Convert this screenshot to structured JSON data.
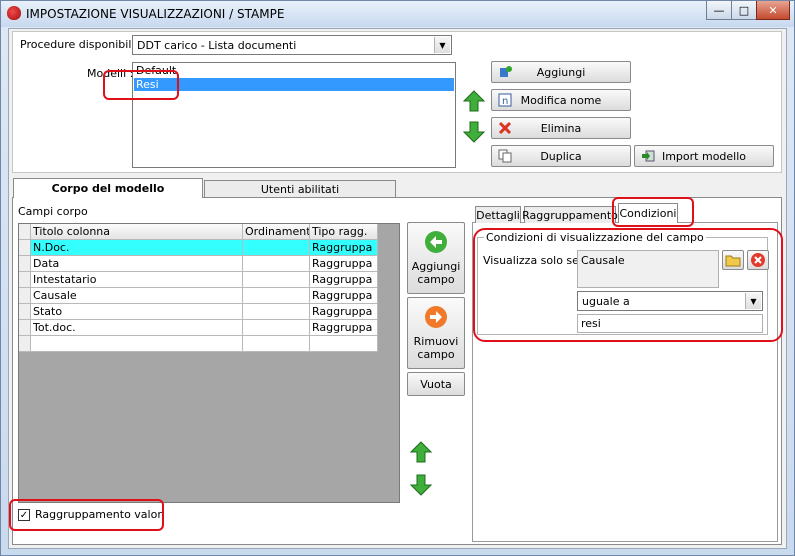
{
  "window": {
    "title": "IMPOSTAZIONE VISUALIZZAZIONI / STAMPE"
  },
  "procedure": {
    "label": "Procedure disponibili :",
    "value": "DDT carico - Lista documenti"
  },
  "modelli": {
    "label": "Modelli :",
    "items": [
      "Default",
      "Resi"
    ],
    "selected_index": 1
  },
  "model_buttons": {
    "aggiungi": "Aggiungi",
    "modifica": "Modifica nome",
    "elimina": "Elimina",
    "duplica": "Duplica",
    "import": "Import modello"
  },
  "main_tabs": [
    "Corpo del modello",
    "Utenti abilitati"
  ],
  "campi": {
    "label": "Campi corpo",
    "columns": [
      "Titolo colonna",
      "Ordinamento",
      "Tipo ragg."
    ],
    "rows": [
      [
        "N.Doc.",
        "",
        "Raggruppa"
      ],
      [
        "Data",
        "",
        "Raggruppa"
      ],
      [
        "Intestatario",
        "",
        "Raggruppa"
      ],
      [
        "Causale",
        "",
        "Raggruppa"
      ],
      [
        "Stato",
        "",
        "Raggruppa"
      ],
      [
        "Tot.doc.",
        "",
        "Raggruppa"
      ]
    ]
  },
  "middle_buttons": {
    "aggiungi_line1": "Aggiungi",
    "aggiungi_line2": "campo",
    "rimuovi_line1": "Rimuovi",
    "rimuovi_line2": "campo",
    "vuota": "Vuota"
  },
  "sub_tabs": [
    "Dettagli",
    "Raggruppamento",
    "Condizioni"
  ],
  "condizioni": {
    "group_title": "Condizioni di visualizzazione del campo",
    "visualizza_label": "Visualizza solo se :",
    "field_value": "Causale",
    "operator": "uguale a",
    "value": "resi"
  },
  "checkbox": {
    "label": "Raggruppamento valori",
    "checked": true
  },
  "colors": {
    "highlight": "#e0101a",
    "selection": "#3399ff",
    "grid_selection": "#33ffff"
  }
}
